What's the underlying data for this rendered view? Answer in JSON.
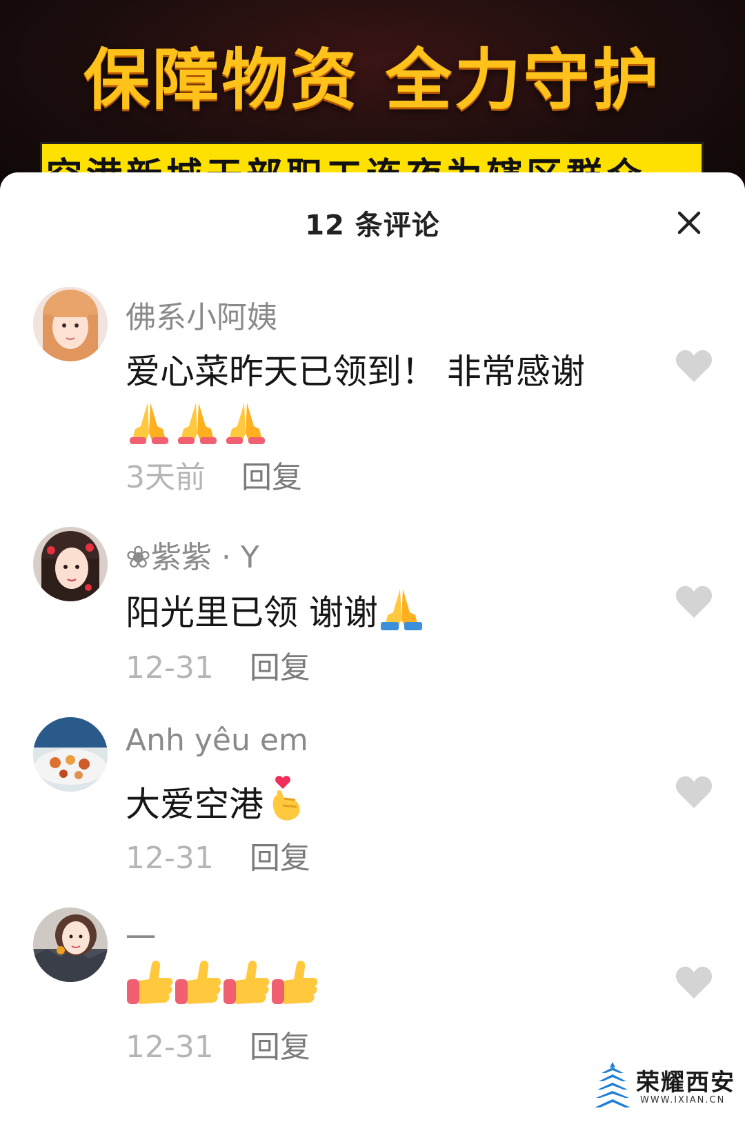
{
  "video": {
    "title": "保障物资 全力守护",
    "subtitle": "空港新城干部职工连夜为辖区群众"
  },
  "sheet": {
    "title": "12 条评论",
    "close_icon": "close-icon"
  },
  "comments": [
    {
      "user": "佛系小阿姨",
      "text": "爱心菜昨天已领到！ 非常感谢",
      "emoji": [
        "folded-hands",
        "folded-hands",
        "folded-hands"
      ],
      "time": "3天前",
      "reply": "回复"
    },
    {
      "user": "❀紫紫 · Y",
      "text": "阳光里已领 谢谢",
      "emoji": [
        "folded-hands-blue"
      ],
      "time": "12-31",
      "reply": "回复"
    },
    {
      "user": "Anh yêu em",
      "text": "大爱空港",
      "emoji": [
        "finger-heart"
      ],
      "time": "12-31",
      "reply": "回复"
    },
    {
      "user": "一",
      "text": "",
      "emoji": [
        "thumbs-up",
        "thumbs-up",
        "thumbs-up",
        "thumbs-up"
      ],
      "time": "12-31",
      "reply": "回复"
    }
  ],
  "watermark": {
    "text": "荣耀西安",
    "url": "WWW.IXIAN.CN"
  },
  "colors": {
    "accent": "#ffc21a",
    "strip": "#ffe100",
    "username": "#8a8a8a",
    "time": "#b5b5b5",
    "like": "#d4d4d4"
  }
}
